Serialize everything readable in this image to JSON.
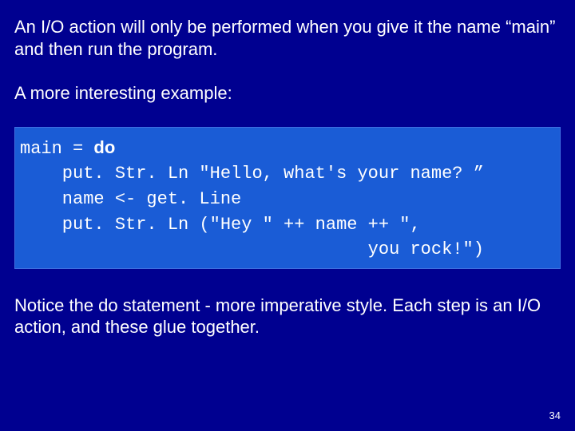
{
  "para1": "An I/O action will only be performed when you give it the name “main” and then run the program.",
  "para2": "A more interesting example:",
  "code_line1_prefix": "main = ",
  "code_line1_bold": "do",
  "code_line2": "    put. Str. Ln \"Hello, what's your name? ”",
  "code_line3": "    name <- get. Line",
  "code_line4": "    put. Str. Ln (\"Hey \" ++ name ++ \", ",
  "code_line5": "                                 you rock!\")",
  "para3": "Notice the do statement - more imperative style. Each step is an I/O action, and these glue together.",
  "page_number": "34"
}
